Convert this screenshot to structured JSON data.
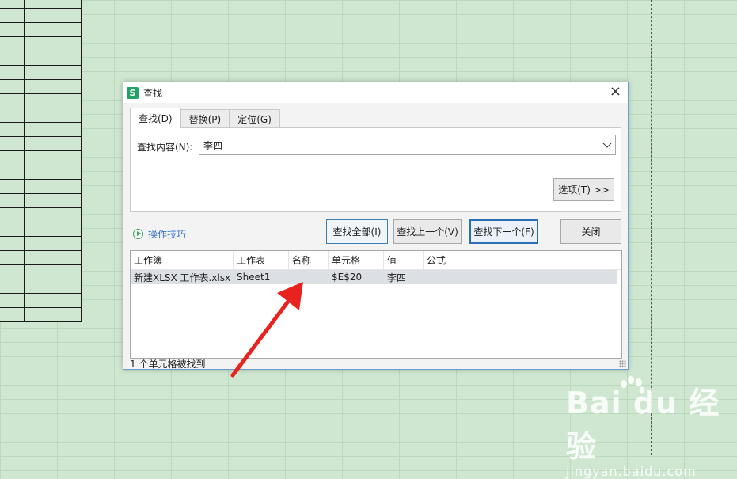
{
  "sheet": {
    "rows": 23
  },
  "dialog": {
    "app_icon": "S",
    "title": "查找",
    "close_icon": "×",
    "tabs": [
      {
        "label": "查找(D)",
        "active": true
      },
      {
        "label": "替换(P)",
        "active": false
      },
      {
        "label": "定位(G)",
        "active": false
      }
    ],
    "find_label": "查找内容(N):",
    "find_value": "李四",
    "options_button": "选项(T) >>",
    "tips_label": "操作技巧",
    "buttons": {
      "find_all": "查找全部(I)",
      "find_prev": "查找上一个(V)",
      "find_next": "查找下一个(F)",
      "close": "关闭"
    },
    "results": {
      "columns": [
        "工作簿",
        "工作表",
        "名称",
        "单元格",
        "值",
        "公式"
      ],
      "rows": [
        {
          "workbook": "新建XLSX 工作表.xlsx",
          "sheet": "Sheet1",
          "name": "",
          "cell": "$E$20",
          "value": "李四",
          "formula": ""
        }
      ]
    },
    "status": "1 个单元格被找到"
  },
  "annotation": {
    "arrow_color": "#e8231f"
  },
  "watermark": {
    "main": "Bai du 经验",
    "sub": "jingyan.baidu.com"
  }
}
